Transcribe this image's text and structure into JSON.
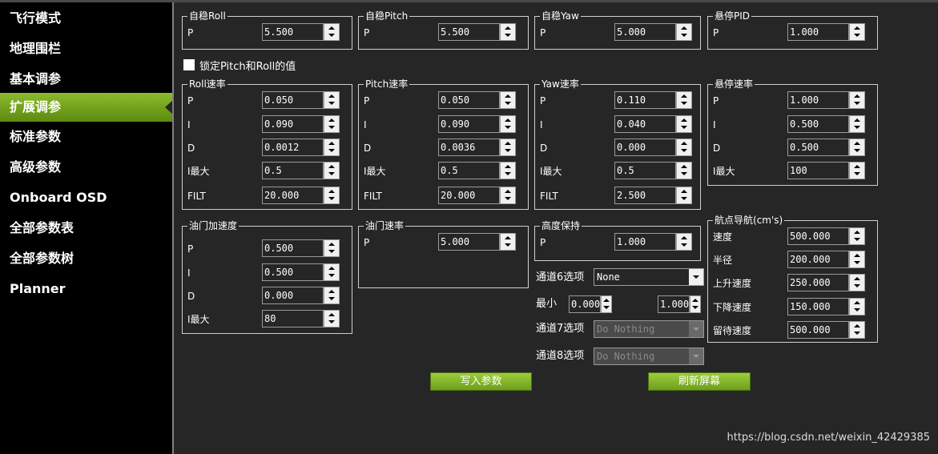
{
  "sidebar": {
    "items": [
      {
        "label": "飞行模式",
        "active": false
      },
      {
        "label": "地理围栏",
        "active": false
      },
      {
        "label": "基本调参",
        "active": false
      },
      {
        "label": "扩展调参",
        "active": true
      },
      {
        "label": "标准参数",
        "active": false
      },
      {
        "label": "高级参数",
        "active": false
      },
      {
        "label": "Onboard OSD",
        "active": false
      },
      {
        "label": "全部参数表",
        "active": false
      },
      {
        "label": "全部参数树",
        "active": false
      },
      {
        "label": "Planner",
        "active": false
      }
    ]
  },
  "groups": {
    "stab_roll": {
      "title": "自稳Roll",
      "rows": [
        {
          "label": "P",
          "value": "5.500"
        }
      ]
    },
    "stab_pitch": {
      "title": "自稳Pitch",
      "rows": [
        {
          "label": "P",
          "value": "5.500"
        }
      ]
    },
    "stab_yaw": {
      "title": "自稳Yaw",
      "rows": [
        {
          "label": "P",
          "value": "5.000"
        }
      ]
    },
    "loiter_pid": {
      "title": "悬停PID",
      "rows": [
        {
          "label": "P",
          "value": "1.000"
        }
      ]
    },
    "roll_rate": {
      "title": "Roll速率",
      "rows": [
        {
          "label": "P",
          "value": "0.050"
        },
        {
          "label": "I",
          "value": "0.090"
        },
        {
          "label": "D",
          "value": "0.0012"
        },
        {
          "label": "I最大",
          "value": "0.5"
        },
        {
          "label": "FILT",
          "value": "20.000"
        }
      ]
    },
    "pitch_rate": {
      "title": "Pitch速率",
      "rows": [
        {
          "label": "P",
          "value": "0.050"
        },
        {
          "label": "I",
          "value": "0.090"
        },
        {
          "label": "D",
          "value": "0.0036"
        },
        {
          "label": "I最大",
          "value": "0.5"
        },
        {
          "label": "FILT",
          "value": "20.000"
        }
      ]
    },
    "yaw_rate": {
      "title": "Yaw速率",
      "rows": [
        {
          "label": "P",
          "value": "0.110"
        },
        {
          "label": "I",
          "value": "0.040"
        },
        {
          "label": "D",
          "value": "0.000"
        },
        {
          "label": "I最大",
          "value": "0.5"
        },
        {
          "label": "FILT",
          "value": "2.500"
        }
      ]
    },
    "loiter_rate": {
      "title": "悬停速率",
      "rows": [
        {
          "label": "P",
          "value": "1.000"
        },
        {
          "label": "I",
          "value": "0.500"
        },
        {
          "label": "D",
          "value": "0.500"
        },
        {
          "label": "I最大",
          "value": "100"
        }
      ]
    },
    "throttle_accel": {
      "title": "油门加速度",
      "rows": [
        {
          "label": "P",
          "value": "0.500"
        },
        {
          "label": "I",
          "value": "0.500"
        },
        {
          "label": "D",
          "value": "0.000"
        },
        {
          "label": "I最大",
          "value": "80"
        }
      ]
    },
    "throttle_rate": {
      "title": "油门速率",
      "rows": [
        {
          "label": "P",
          "value": "5.000"
        }
      ]
    },
    "alt_hold": {
      "title": "高度保持",
      "rows": [
        {
          "label": "P",
          "value": "1.000"
        }
      ]
    },
    "wpnav": {
      "title": "航点导航(cm's)",
      "rows": [
        {
          "label": "速度",
          "value": "500.000"
        },
        {
          "label": "半径",
          "value": "200.000"
        },
        {
          "label": "上升速度",
          "value": "250.000"
        },
        {
          "label": "下降速度",
          "value": "150.000"
        },
        {
          "label": "留待速度",
          "value": "500.000"
        }
      ]
    }
  },
  "lock_checkbox": {
    "label": "锁定Pitch和Roll的值",
    "checked": false
  },
  "ch6": {
    "label": "通道6选项",
    "selected": "None"
  },
  "ch6_range": {
    "min_label": "最小",
    "min_value": "0.000",
    "max_value": "1.000"
  },
  "ch7": {
    "label": "通道7选项",
    "selected": "Do Nothing"
  },
  "ch8": {
    "label": "通道8选项",
    "selected": "Do Nothing"
  },
  "buttons": {
    "write": "写入参数",
    "refresh": "刷新屏幕"
  },
  "watermark": "https://blog.csdn.net/weixin_42429385"
}
